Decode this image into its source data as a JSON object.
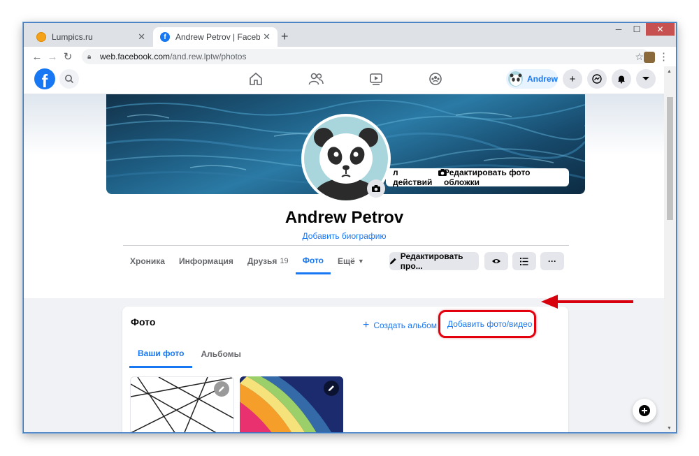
{
  "browser": {
    "tabs": [
      {
        "title": "Lumpics.ru",
        "icon": "orange-circle-favicon"
      },
      {
        "title": "Andrew Petrov | Facebook",
        "icon": "facebook-favicon"
      }
    ],
    "new_tab": "+",
    "window_controls": {
      "minimize": "─",
      "maximize": "☐",
      "close": "✕"
    },
    "url_host": "web.facebook.com",
    "url_path": "/and.rew.lptw/photos"
  },
  "facebook": {
    "logo": "f",
    "user_chip": "Andrew",
    "profile_name": "Andrew Petrov",
    "add_bio": "Добавить биографию",
    "cover_partial_button": "л действий",
    "edit_cover_button": "Редактировать фото обложки",
    "tabs": [
      {
        "label": "Хроника"
      },
      {
        "label": "Информация"
      },
      {
        "label": "Друзья",
        "count": "19"
      },
      {
        "label": "Фото",
        "active": true
      },
      {
        "label": "Ещё"
      }
    ],
    "edit_profile_button": "Редактировать про...",
    "photos": {
      "title": "Фото",
      "create_album": "Создать альбом",
      "add_photo_video": "Добавить фото/видео",
      "subtabs": [
        {
          "label": "Ваши фото",
          "active": true
        },
        {
          "label": "Альбомы"
        }
      ]
    }
  },
  "colors": {
    "facebook_blue": "#1877f2",
    "highlight_red": "#e3000f"
  }
}
